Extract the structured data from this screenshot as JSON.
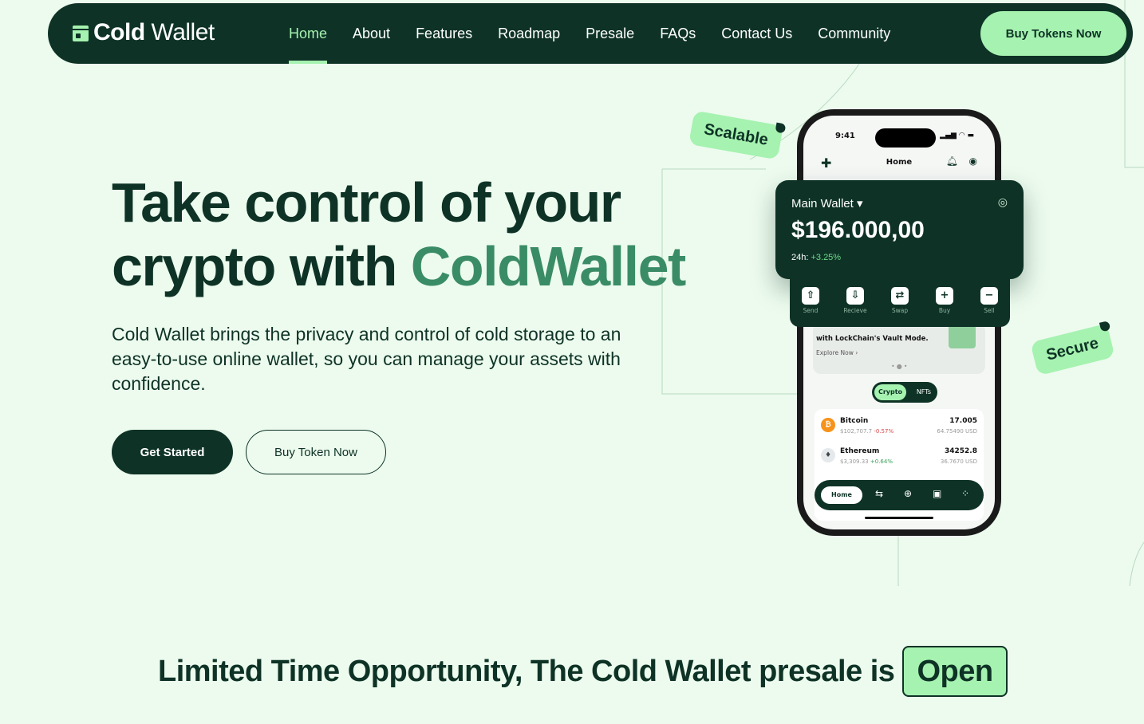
{
  "brand": {
    "logo_bold": "Cold",
    "logo_light": " Wallet"
  },
  "nav": {
    "items": [
      {
        "label": "Home",
        "active": true
      },
      {
        "label": "About"
      },
      {
        "label": "Features"
      },
      {
        "label": "Roadmap"
      },
      {
        "label": "Presale"
      },
      {
        "label": "FAQs"
      },
      {
        "label": "Contact Us"
      },
      {
        "label": "Community"
      }
    ],
    "cta": "Buy Tokens Now"
  },
  "hero": {
    "title_line1": "Take control of your",
    "title_line2_prefix": "crypto with ",
    "title_accent": "ColdWallet",
    "subtitle": "Cold Wallet brings the privacy and control of cold storage to an easy-to-use online wallet, so you can manage your assets with confidence.",
    "primary_button": "Get Started",
    "secondary_button": "Buy Token Now"
  },
  "tags": {
    "scalable": "Scalable",
    "secure": "Secure"
  },
  "phone": {
    "time": "9:41",
    "status_icons": "▂▄▆ ◠ ▬",
    "screen_title": "Home",
    "wallet_label": "Main Wallet ▾",
    "balance": "$196.000,00",
    "change_label": "24h: ",
    "change_value": "+3.25%",
    "actions": [
      "Send",
      "Recieve",
      "Swap",
      "Buy",
      "Sell"
    ],
    "promo_text": "with LockChain's Vault Mode.",
    "promo_link": "Explore Now  ›",
    "segment_a": "Crypto",
    "segment_b": "NFTs",
    "coins": [
      {
        "name": "Bitcoin",
        "price": "$102,707.7",
        "change": "-0.57%",
        "amount": "17.005",
        "usd": "64.75490 USD",
        "color": "#f7931a"
      },
      {
        "name": "Ethereum",
        "price": "$3,309.33",
        "change": "+0.64%",
        "amount": "34252.8",
        "usd": "36.7670 USD",
        "color": "#c8ccd0"
      }
    ],
    "tab_home": "Home"
  },
  "banner": {
    "text": "Limited Time Opportunity, The Cold Wallet presale is",
    "pill": "Open"
  },
  "colors": {
    "dark": "#0e3326",
    "mint": "#a6f2b0",
    "accent": "#3a8c66",
    "background": "#ecfbee"
  }
}
